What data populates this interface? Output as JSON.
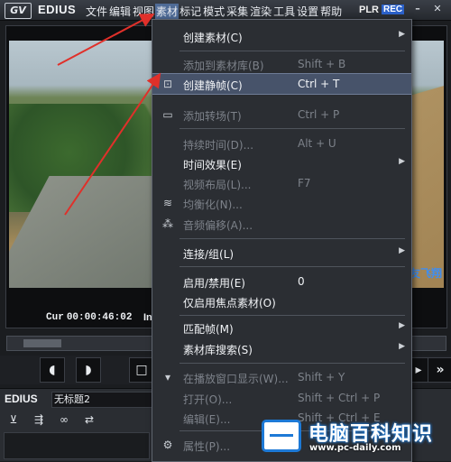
{
  "titlebar": {
    "logo": "GV",
    "app_name": "EDIUS",
    "menus": [
      "文件",
      "编辑",
      "视图",
      "素材",
      "标记",
      "模式",
      "采集",
      "渲染",
      "工具",
      "设置",
      "帮助"
    ],
    "plr": "PLR",
    "rec": "REC"
  },
  "player": {
    "cur_label": "Cur",
    "cur_time": "00:00:46:02",
    "in_label": "In",
    "overlay_text": "友飞翔"
  },
  "lower": {
    "app_name": "EDIUS",
    "project_name": "无标题2"
  },
  "context_menu": {
    "items": [
      {
        "label": "创建素材(C)",
        "shortcut": "",
        "submenu": true,
        "disabled": false,
        "icon": ""
      },
      {
        "label": "添加到素材库(B)",
        "shortcut": "Shift + B",
        "submenu": false,
        "disabled": true,
        "icon": ""
      },
      {
        "label": "创建静帧(C)",
        "shortcut": "Ctrl + T",
        "submenu": false,
        "disabled": false,
        "icon": "camera-icon",
        "highlighted": true
      },
      {
        "label": "添加转场(T)",
        "shortcut": "Ctrl + P",
        "submenu": false,
        "disabled": true,
        "icon": "transition-icon"
      },
      {
        "label": "持续时间(D)...",
        "shortcut": "Alt + U",
        "submenu": false,
        "disabled": true,
        "icon": ""
      },
      {
        "label": "时间效果(E)",
        "shortcut": "",
        "submenu": true,
        "disabled": false,
        "icon": ""
      },
      {
        "label": "视频布局(L)...",
        "shortcut": "F7",
        "submenu": false,
        "disabled": true,
        "icon": ""
      },
      {
        "label": "均衡化(N)...",
        "shortcut": "",
        "submenu": false,
        "disabled": true,
        "icon": "waveform-icon"
      },
      {
        "label": "音频偏移(A)...",
        "shortcut": "",
        "submenu": false,
        "disabled": true,
        "icon": "audio-offset-icon"
      },
      {
        "label": "连接/组(L)",
        "shortcut": "",
        "submenu": true,
        "disabled": false,
        "icon": ""
      },
      {
        "label": "启用/禁用(E)",
        "shortcut": "0",
        "submenu": false,
        "disabled": false,
        "icon": ""
      },
      {
        "label": "仅启用焦点素材(O)",
        "shortcut": "",
        "submenu": false,
        "disabled": false,
        "icon": ""
      },
      {
        "label": "匹配帧(M)",
        "shortcut": "",
        "submenu": true,
        "disabled": false,
        "icon": ""
      },
      {
        "label": "素材库搜索(S)",
        "shortcut": "",
        "submenu": true,
        "disabled": false,
        "icon": ""
      },
      {
        "label": "在播放窗口显示(W)...",
        "shortcut": "Shift + Y",
        "submenu": false,
        "disabled": true,
        "icon": "monitor-icon"
      },
      {
        "label": "打开(O)...",
        "shortcut": "Shift + Ctrl + P",
        "submenu": false,
        "disabled": true,
        "icon": ""
      },
      {
        "label": "编辑(E)...",
        "shortcut": "Shift + Ctrl + E",
        "submenu": false,
        "disabled": true,
        "icon": ""
      },
      {
        "label": "属性(P)...",
        "shortcut": "",
        "submenu": false,
        "disabled": true,
        "icon": "properties-icon"
      }
    ]
  },
  "watermark": {
    "title": "电脑百科知识",
    "url": "www.pc-daily.com"
  },
  "colors": {
    "menu_bg": "#2b2e33",
    "highlight": "#47536a",
    "annotation_arrow": "#e0302a",
    "watermark_blue": "#1d79d6"
  }
}
